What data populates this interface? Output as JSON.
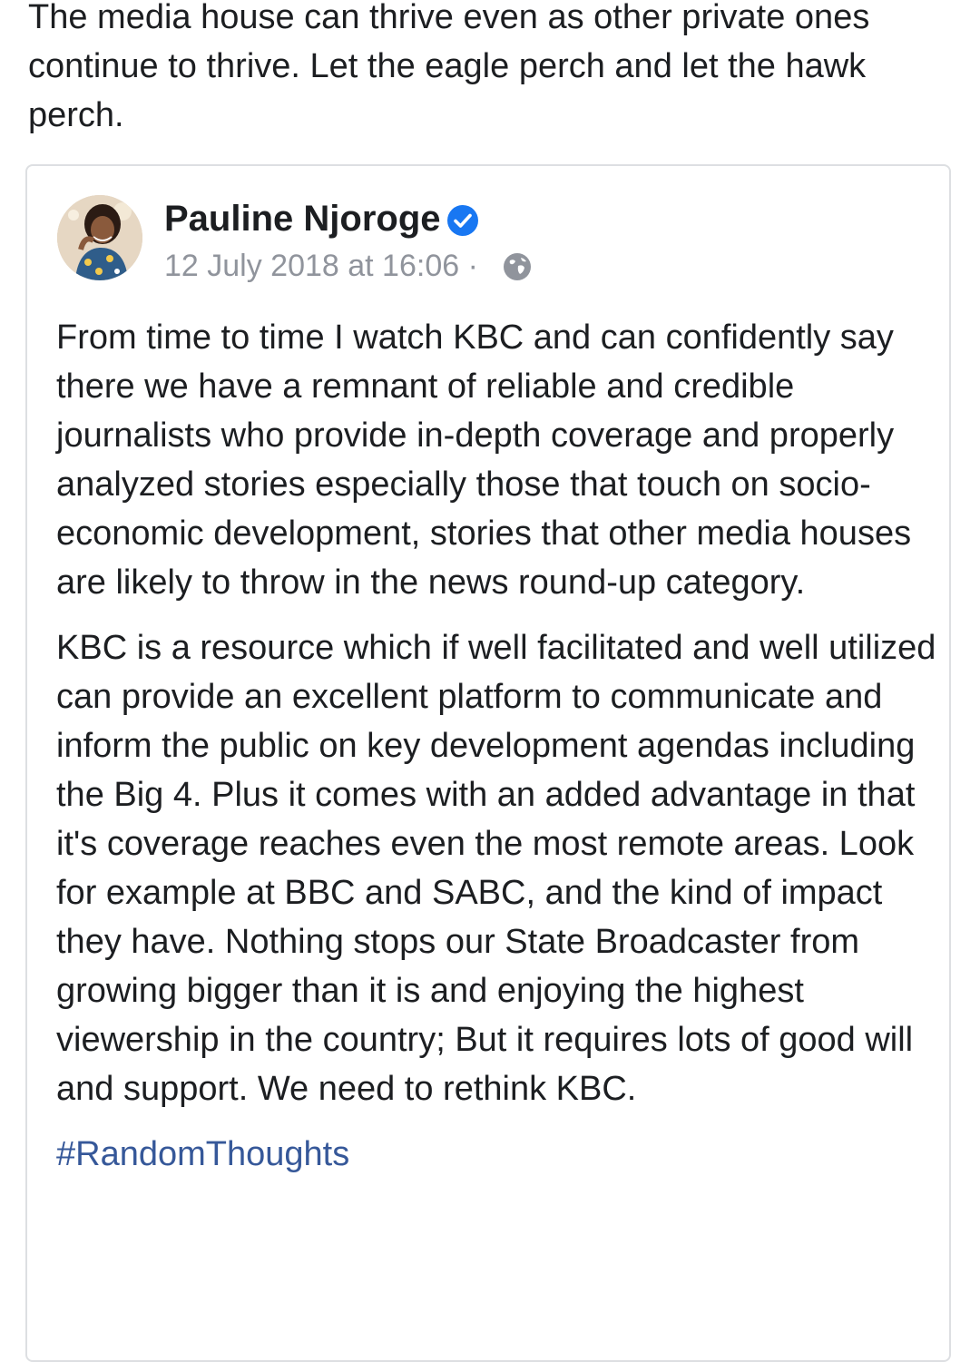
{
  "intro": {
    "text": "The media house can thrive even as other private ones continue to thrive. Let the eagle perch and let the hawk perch."
  },
  "shared_post": {
    "author": "Pauline Njoroge",
    "timestamp": "12 July 2018 at 16:06",
    "separator": "·",
    "audience_icon": "globe-icon",
    "verified_icon": "verified-badge-icon",
    "paragraphs": [
      "From time to time I watch KBC and can confidently say there we have a remnant of reliable and credible journalists who provide in-depth coverage and properly analyzed stories especially those that touch on socio-economic development, stories that other media houses are likely to throw in the news round-up category.",
      "KBC is a resource which if well facilitated and well utilized can provide an excellent platform to communicate and inform the public on key development agendas including the Big 4. Plus it comes with an added advantage in that it's coverage reaches even the most remote areas. Look for example at BBC and SABC, and the kind of impact they have. Nothing stops our State Broadcaster from growing bigger than it is and enjoying the highest viewership in the country; But it requires lots of good will and support. We need to rethink KBC."
    ],
    "hashtag": "#RandomThoughts"
  },
  "colors": {
    "text": "#1c1e21",
    "meta": "#90949c",
    "link": "#365899",
    "verified": "#1877f2",
    "border": "#dddfe2"
  }
}
